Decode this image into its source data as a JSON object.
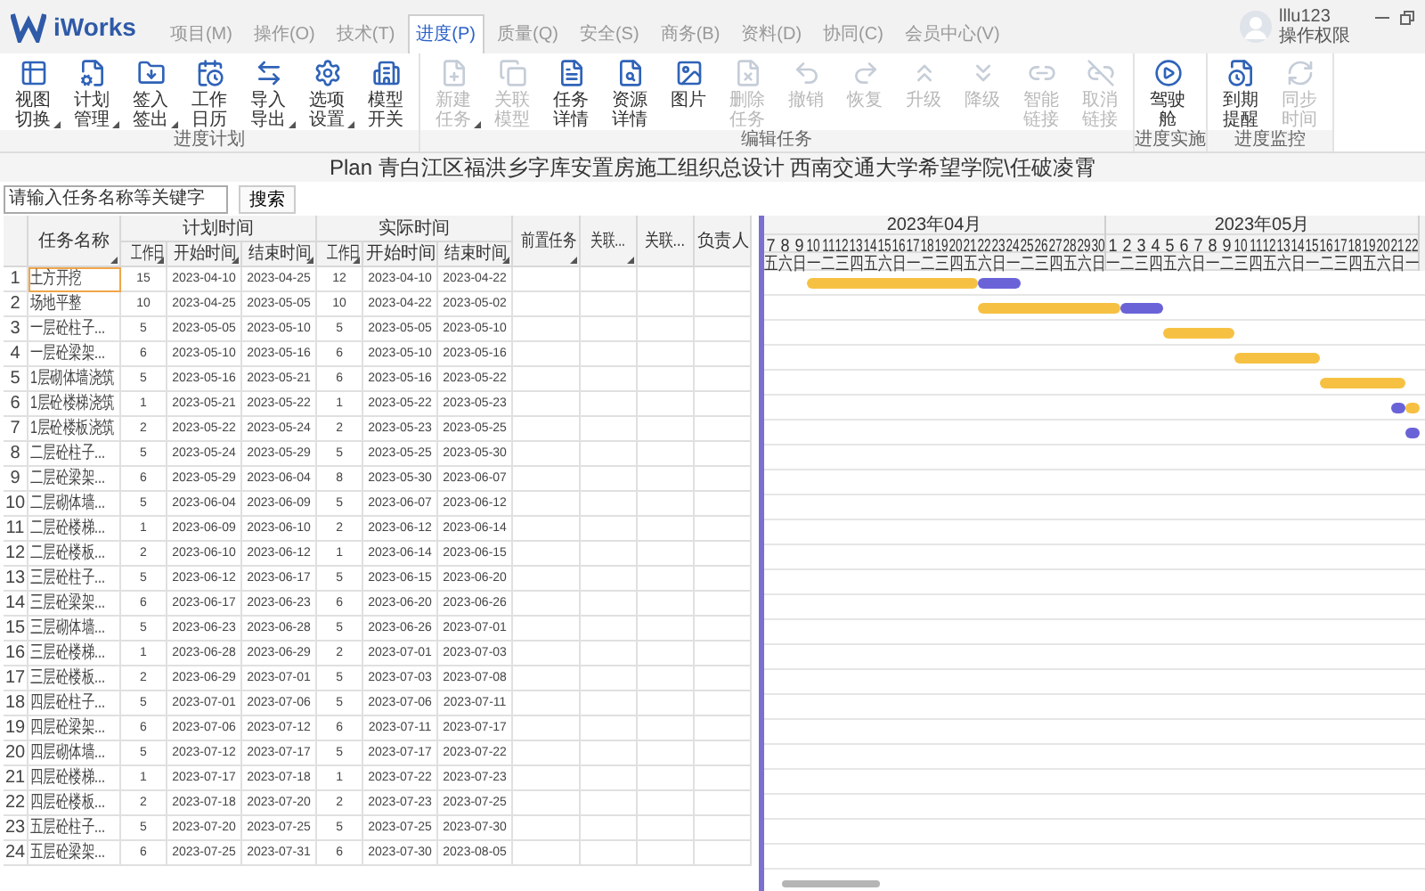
{
  "app": {
    "name": "iWorks"
  },
  "tabs": [
    {
      "label": "项目(M)",
      "selected": false
    },
    {
      "label": "操作(O)",
      "selected": false
    },
    {
      "label": "技术(T)",
      "selected": false
    },
    {
      "label": "进度(P)",
      "selected": true
    },
    {
      "label": "质量(Q)",
      "selected": false
    },
    {
      "label": "安全(S)",
      "selected": false
    },
    {
      "label": "商务(B)",
      "selected": false
    },
    {
      "label": "资料(D)",
      "selected": false
    },
    {
      "label": "协同(C)",
      "selected": false
    },
    {
      "label": "会员中心(V)",
      "selected": false
    }
  ],
  "user": {
    "name": "lllu123",
    "role": "操作权限"
  },
  "ribbon": [
    {
      "label": "进度计划",
      "buttons": [
        {
          "label": "视图切换",
          "dropdown": true,
          "disabled": false
        },
        {
          "label": "计划管理",
          "dropdown": true,
          "disabled": false
        },
        {
          "label": "签入签出",
          "dropdown": true,
          "disabled": false
        },
        {
          "label": "工作日历",
          "dropdown": false,
          "disabled": false
        },
        {
          "label": "导入导出",
          "dropdown": true,
          "disabled": false
        },
        {
          "label": "选项设置",
          "dropdown": true,
          "disabled": false
        },
        {
          "label": "模型开关",
          "dropdown": false,
          "disabled": false
        }
      ]
    },
    {
      "label": "编辑任务",
      "buttons": [
        {
          "label": "新建任务",
          "dropdown": true,
          "disabled": true
        },
        {
          "label": "关联模型",
          "dropdown": false,
          "disabled": true
        },
        {
          "label": "任务详情",
          "dropdown": false,
          "disabled": false
        },
        {
          "label": "资源详情",
          "dropdown": false,
          "disabled": false
        },
        {
          "label": "图片",
          "dropdown": false,
          "disabled": false
        },
        {
          "label": "删除任务",
          "dropdown": false,
          "disabled": true
        },
        {
          "label": "撤销",
          "dropdown": false,
          "disabled": true
        },
        {
          "label": "恢复",
          "dropdown": false,
          "disabled": true
        },
        {
          "label": "升级",
          "dropdown": false,
          "disabled": true
        },
        {
          "label": "降级",
          "dropdown": false,
          "disabled": true
        },
        {
          "label": "智能链接",
          "dropdown": false,
          "disabled": true
        },
        {
          "label": "取消链接",
          "dropdown": false,
          "disabled": true
        }
      ]
    },
    {
      "label": "进度实施",
      "buttons": [
        {
          "label": "驾驶舱",
          "dropdown": false,
          "disabled": false
        }
      ]
    },
    {
      "label": "进度监控",
      "buttons": [
        {
          "label": "到期提醒",
          "dropdown": false,
          "disabled": false
        },
        {
          "label": "同步时间",
          "dropdown": false,
          "disabled": true
        }
      ]
    }
  ],
  "title": "Plan 青白江区福洪乡字库安置房施工组织总设计 西南交通大学希望学院\\任破凌霄",
  "search": {
    "placeholder": "请输入任务名称等关键字",
    "button": "搜索"
  },
  "table": {
    "columns": [
      {
        "label": "任务名称",
        "filter": true
      },
      {
        "group": "计划时间",
        "columns": [
          {
            "label": "工作日",
            "filter": true
          },
          {
            "label": "开始时间",
            "filter": true
          },
          {
            "label": "结束时间",
            "filter": true
          }
        ]
      },
      {
        "group": "实际时间",
        "columns": [
          {
            "label": "工作日",
            "filter": true
          },
          {
            "label": "开始时间",
            "filter": false
          },
          {
            "label": "结束时间",
            "filter": true
          }
        ]
      },
      {
        "label": "前置任务",
        "filter": true
      },
      {
        "label": "关联...",
        "filter": true
      },
      {
        "label": "关联...",
        "filter": false
      },
      {
        "label": "负责人",
        "filter": false
      }
    ],
    "rows": [
      {
        "no": "1",
        "name": "土方开挖",
        "selected": true,
        "plan": [
          "15",
          "2023-04-10",
          "2023-04-25"
        ],
        "actual": [
          "12",
          "2023-04-10",
          "2023-04-22"
        ]
      },
      {
        "no": "2",
        "name": "场地平整",
        "selected": false,
        "plan": [
          "10",
          "2023-04-25",
          "2023-05-05"
        ],
        "actual": [
          "10",
          "2023-04-22",
          "2023-05-02"
        ]
      },
      {
        "no": "3",
        "name": "一层砼柱子...",
        "selected": false,
        "plan": [
          "5",
          "2023-05-05",
          "2023-05-10"
        ],
        "actual": [
          "5",
          "2023-05-05",
          "2023-05-10"
        ]
      },
      {
        "no": "4",
        "name": "一层砼梁架...",
        "selected": false,
        "plan": [
          "6",
          "2023-05-10",
          "2023-05-16"
        ],
        "actual": [
          "6",
          "2023-05-10",
          "2023-05-16"
        ]
      },
      {
        "no": "5",
        "name": "1层砌体墙浇筑",
        "selected": false,
        "plan": [
          "5",
          "2023-05-16",
          "2023-05-21"
        ],
        "actual": [
          "6",
          "2023-05-16",
          "2023-05-22"
        ]
      },
      {
        "no": "6",
        "name": "1层砼楼梯浇筑",
        "selected": false,
        "plan": [
          "1",
          "2023-05-21",
          "2023-05-22"
        ],
        "actual": [
          "1",
          "2023-05-22",
          "2023-05-23"
        ]
      },
      {
        "no": "7",
        "name": "1层砼楼板浇筑",
        "selected": false,
        "plan": [
          "2",
          "2023-05-22",
          "2023-05-24"
        ],
        "actual": [
          "2",
          "2023-05-23",
          "2023-05-25"
        ]
      },
      {
        "no": "8",
        "name": "二层砼柱子...",
        "selected": false,
        "plan": [
          "5",
          "2023-05-24",
          "2023-05-29"
        ],
        "actual": [
          "5",
          "2023-05-25",
          "2023-05-30"
        ]
      },
      {
        "no": "9",
        "name": "二层砼梁架...",
        "selected": false,
        "plan": [
          "6",
          "2023-05-29",
          "2023-06-04"
        ],
        "actual": [
          "8",
          "2023-05-30",
          "2023-06-07"
        ]
      },
      {
        "no": "10",
        "name": "二层砌体墙...",
        "selected": false,
        "plan": [
          "5",
          "2023-06-04",
          "2023-06-09"
        ],
        "actual": [
          "5",
          "2023-06-07",
          "2023-06-12"
        ]
      },
      {
        "no": "11",
        "name": "二层砼楼梯...",
        "selected": false,
        "plan": [
          "1",
          "2023-06-09",
          "2023-06-10"
        ],
        "actual": [
          "2",
          "2023-06-12",
          "2023-06-14"
        ]
      },
      {
        "no": "12",
        "name": "二层砼楼板...",
        "selected": false,
        "plan": [
          "2",
          "2023-06-10",
          "2023-06-12"
        ],
        "actual": [
          "1",
          "2023-06-14",
          "2023-06-15"
        ]
      },
      {
        "no": "13",
        "name": "三层砼柱子...",
        "selected": false,
        "plan": [
          "5",
          "2023-06-12",
          "2023-06-17"
        ],
        "actual": [
          "5",
          "2023-06-15",
          "2023-06-20"
        ]
      },
      {
        "no": "14",
        "name": "三层砼梁架...",
        "selected": false,
        "plan": [
          "6",
          "2023-06-17",
          "2023-06-23"
        ],
        "actual": [
          "6",
          "2023-06-20",
          "2023-06-26"
        ]
      },
      {
        "no": "15",
        "name": "三层砌体墙...",
        "selected": false,
        "plan": [
          "5",
          "2023-06-23",
          "2023-06-28"
        ],
        "actual": [
          "5",
          "2023-06-26",
          "2023-07-01"
        ]
      },
      {
        "no": "16",
        "name": "三层砼楼梯...",
        "selected": false,
        "plan": [
          "1",
          "2023-06-28",
          "2023-06-29"
        ],
        "actual": [
          "2",
          "2023-07-01",
          "2023-07-03"
        ]
      },
      {
        "no": "17",
        "name": "三层砼楼板...",
        "selected": false,
        "plan": [
          "2",
          "2023-06-29",
          "2023-07-01"
        ],
        "actual": [
          "5",
          "2023-07-03",
          "2023-07-08"
        ]
      },
      {
        "no": "18",
        "name": "四层砼柱子...",
        "selected": false,
        "plan": [
          "5",
          "2023-07-01",
          "2023-07-06"
        ],
        "actual": [
          "5",
          "2023-07-06",
          "2023-07-11"
        ]
      },
      {
        "no": "19",
        "name": "四层砼梁架...",
        "selected": false,
        "plan": [
          "6",
          "2023-07-06",
          "2023-07-12"
        ],
        "actual": [
          "6",
          "2023-07-11",
          "2023-07-17"
        ]
      },
      {
        "no": "20",
        "name": "四层砌体墙...",
        "selected": false,
        "plan": [
          "5",
          "2023-07-12",
          "2023-07-17"
        ],
        "actual": [
          "5",
          "2023-07-17",
          "2023-07-22"
        ]
      },
      {
        "no": "21",
        "name": "四层砼楼梯...",
        "selected": false,
        "plan": [
          "1",
          "2023-07-17",
          "2023-07-18"
        ],
        "actual": [
          "1",
          "2023-07-22",
          "2023-07-23"
        ]
      },
      {
        "no": "22",
        "name": "四层砼楼板...",
        "selected": false,
        "plan": [
          "2",
          "2023-07-18",
          "2023-07-20"
        ],
        "actual": [
          "2",
          "2023-07-23",
          "2023-07-25"
        ]
      },
      {
        "no": "23",
        "name": "五层砼柱子...",
        "selected": false,
        "plan": [
          "5",
          "2023-07-20",
          "2023-07-25"
        ],
        "actual": [
          "5",
          "2023-07-25",
          "2023-07-30"
        ]
      },
      {
        "no": "24",
        "name": "五层砼梁架...",
        "selected": false,
        "plan": [
          "6",
          "2023-07-25",
          "2023-07-31"
        ],
        "actual": [
          "6",
          "2023-07-30",
          "2023-08-05"
        ]
      }
    ]
  },
  "gantt": {
    "months": [
      {
        "label": "2023年04月",
        "days": [
          "7",
          "8",
          "9",
          "10",
          "11",
          "12",
          "13",
          "14",
          "15",
          "16",
          "17",
          "18",
          "19",
          "20",
          "21",
          "22",
          "23",
          "24",
          "25",
          "26",
          "27",
          "28",
          "29",
          "30"
        ],
        "weekdays": [
          "五",
          "六",
          "日",
          "一",
          "二",
          "三",
          "四",
          "五",
          "六",
          "日",
          "一",
          "二",
          "三",
          "四",
          "五",
          "六",
          "日",
          "一",
          "二",
          "三",
          "四",
          "五",
          "六",
          "日"
        ]
      },
      {
        "label": "2023年05月",
        "days": [
          "1",
          "2",
          "3",
          "4",
          "5",
          "6",
          "7",
          "8",
          "9",
          "10",
          "11",
          "12",
          "13",
          "14",
          "15",
          "16",
          "17",
          "18",
          "19",
          "20",
          "21",
          "22"
        ],
        "weekdays": [
          "一",
          "二",
          "三",
          "四",
          "五",
          "六",
          "日",
          "一",
          "二",
          "三",
          "四",
          "五",
          "六",
          "日",
          "一",
          "二",
          "三",
          "四",
          "五",
          "六",
          "日",
          "一"
        ]
      }
    ]
  }
}
